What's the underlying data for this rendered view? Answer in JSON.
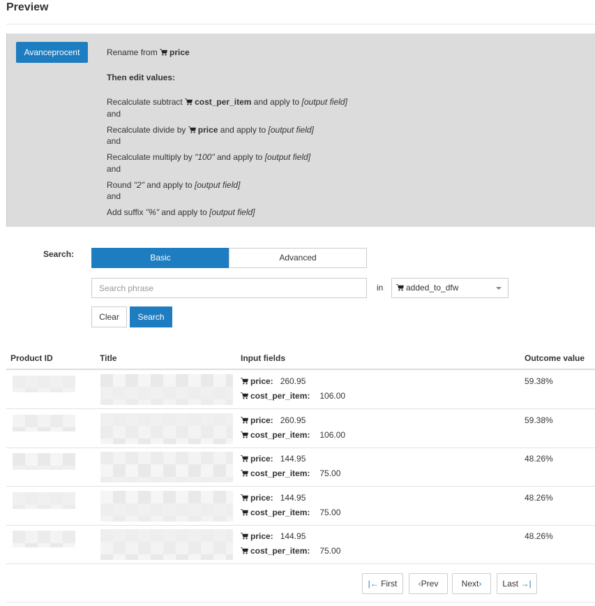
{
  "preview_title": "Preview",
  "rule": {
    "action_label": "Avanceprocent",
    "rename_prefix": "Rename from",
    "rename_field": "price",
    "then_edit": "Then edit values:",
    "steps": [
      {
        "pre": "Recalculate subtract",
        "field": "cost_per_item",
        "post": "and apply to",
        "out": "[output field]"
      },
      {
        "pre": "Recalculate divide by",
        "field": "price",
        "post": "and apply to",
        "out": "[output field]"
      },
      {
        "pre": "Recalculate multiply by",
        "value": "\"100\"",
        "post": "and apply to",
        "out": "[output field]"
      },
      {
        "pre": "Round",
        "value": "\"2\"",
        "post": "and apply to",
        "out": "[output field]"
      },
      {
        "pre": "Add suffix",
        "value": "\"%\"",
        "post": "and apply to",
        "out": "[output field]"
      }
    ],
    "and_label": "and"
  },
  "search": {
    "label": "Search:",
    "tab_basic": "Basic",
    "tab_advanced": "Advanced",
    "placeholder": "Search phrase",
    "in_label": "in",
    "field_selected": "added_to_dfw",
    "clear_label": "Clear",
    "search_label": "Search"
  },
  "table": {
    "headers": {
      "product_id": "Product ID",
      "title": "Title",
      "input_fields": "Input fields",
      "outcome": "Outcome value"
    },
    "field_names": {
      "price": "price:",
      "cost": "cost_per_item:"
    },
    "rows": [
      {
        "price": "260.95",
        "cost": "106.00",
        "outcome": "59.38%"
      },
      {
        "price": "260.95",
        "cost": "106.00",
        "outcome": "59.38%"
      },
      {
        "price": "144.95",
        "cost": "75.00",
        "outcome": "48.26%"
      },
      {
        "price": "144.95",
        "cost": "75.00",
        "outcome": "48.26%"
      },
      {
        "price": "144.95",
        "cost": "75.00",
        "outcome": "48.26%"
      }
    ]
  },
  "pagination": {
    "first": "First",
    "prev": "Prev",
    "next": "Next",
    "last": "Last"
  },
  "colors": {
    "accent": "#1e7dc0",
    "panel_bg": "#dcdcdc"
  },
  "icons": [
    "cart-icon",
    "chevron-down-icon",
    "first-page-icon",
    "chevron-left-icon",
    "chevron-right-icon",
    "last-page-icon"
  ]
}
